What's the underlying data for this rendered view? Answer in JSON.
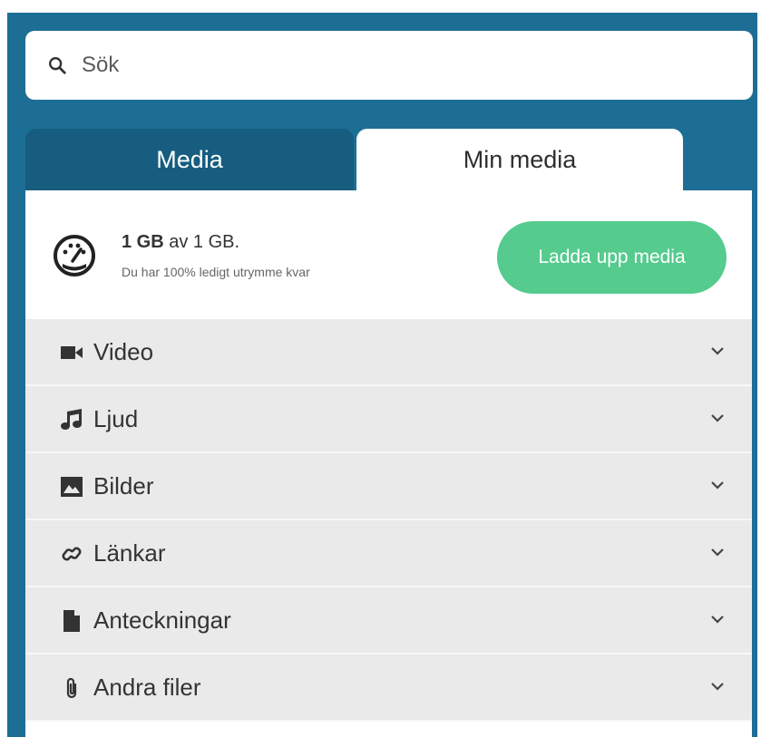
{
  "search": {
    "placeholder": "Sök"
  },
  "tabs": [
    {
      "label": "Media",
      "active": false
    },
    {
      "label": "Min media",
      "active": true
    }
  ],
  "storage": {
    "used_bold": "1 GB",
    "used_rest": " av 1 GB.",
    "free_text": "Du har 100% ledigt utrymme kvar"
  },
  "upload_button": {
    "label": "Ladda upp media"
  },
  "categories": [
    {
      "label": "Video",
      "icon": "video-camera-icon"
    },
    {
      "label": "Ljud",
      "icon": "music-note-icon"
    },
    {
      "label": "Bilder",
      "icon": "image-icon"
    },
    {
      "label": "Länkar",
      "icon": "link-icon"
    },
    {
      "label": "Anteckningar",
      "icon": "document-icon"
    },
    {
      "label": "Andra filer",
      "icon": "paperclip-icon"
    }
  ],
  "colors": {
    "frame": "#1d6e95",
    "inactive_tab": "#165d7f",
    "upload_button": "#55cb8e",
    "category_bg": "#eaeaea"
  }
}
